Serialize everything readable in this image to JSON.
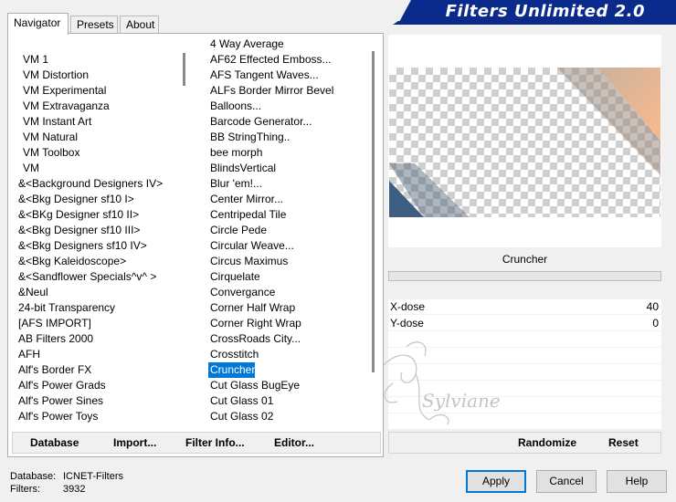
{
  "tabs": [
    {
      "label": "Navigator"
    },
    {
      "label": "Presets"
    },
    {
      "label": "About"
    }
  ],
  "title": "Filters Unlimited 2.0",
  "categories": [
    "VM 1",
    "VM Distortion",
    "VM Experimental",
    "VM Extravaganza",
    "VM Instant Art",
    "VM Natural",
    "VM Toolbox",
    "VM",
    "&<Background Designers IV>",
    "&<Bkg Designer sf10 I>",
    "&<BKg Designer sf10 II>",
    "&<Bkg Designer sf10 III>",
    "&<Bkg Designers sf10 IV>",
    "&<Bkg Kaleidoscope>",
    "&<Sandflower Specials^v^ >",
    "&Neul",
    "24-bit Transparency",
    "[AFS IMPORT]",
    "AB Filters 2000",
    "AFH",
    "Alf's Border FX",
    "Alf's Power Grads",
    "Alf's Power Sines",
    "Alf's Power Toys"
  ],
  "filters": [
    "4 Way Average",
    "AF62 Effected Emboss...",
    "AFS Tangent Waves...",
    "ALFs Border Mirror Bevel",
    "Balloons...",
    "Barcode Generator...",
    "BB StringThing..",
    "bee morph",
    "BlindsVertical",
    "Blur 'em!...",
    "Center Mirror...",
    "Centripedal Tile",
    "Circle Pede",
    "Circular Weave...",
    "Circus Maximus",
    "Cirquelate",
    "Convergance",
    "Corner Half Wrap",
    "Corner Right Wrap",
    "CrossRoads City...",
    "Crosstitch",
    "Cruncher",
    "Cut Glass  BugEye",
    "Cut Glass 01",
    "Cut Glass 02"
  ],
  "selected_filter": "Cruncher",
  "params": [
    {
      "label": "X-dose",
      "value": "40"
    },
    {
      "label": "Y-dose",
      "value": "0"
    }
  ],
  "toolbar": {
    "database": "Database",
    "import": "Import...",
    "filter_info": "Filter Info...",
    "editor": "Editor...",
    "randomize": "Randomize",
    "reset": "Reset"
  },
  "status": {
    "database_label": "Database:",
    "database_value": "ICNET-Filters",
    "filters_label": "Filters:",
    "filters_value": "3932"
  },
  "buttons": {
    "apply": "Apply",
    "cancel": "Cancel",
    "help": "Help"
  },
  "watermark_text": "Sylviane",
  "colors": {
    "banner": "#0a2a8c",
    "selection": "#0078d7",
    "preview_peach": "#fdb98a",
    "preview_blue": "#3d5e80"
  }
}
